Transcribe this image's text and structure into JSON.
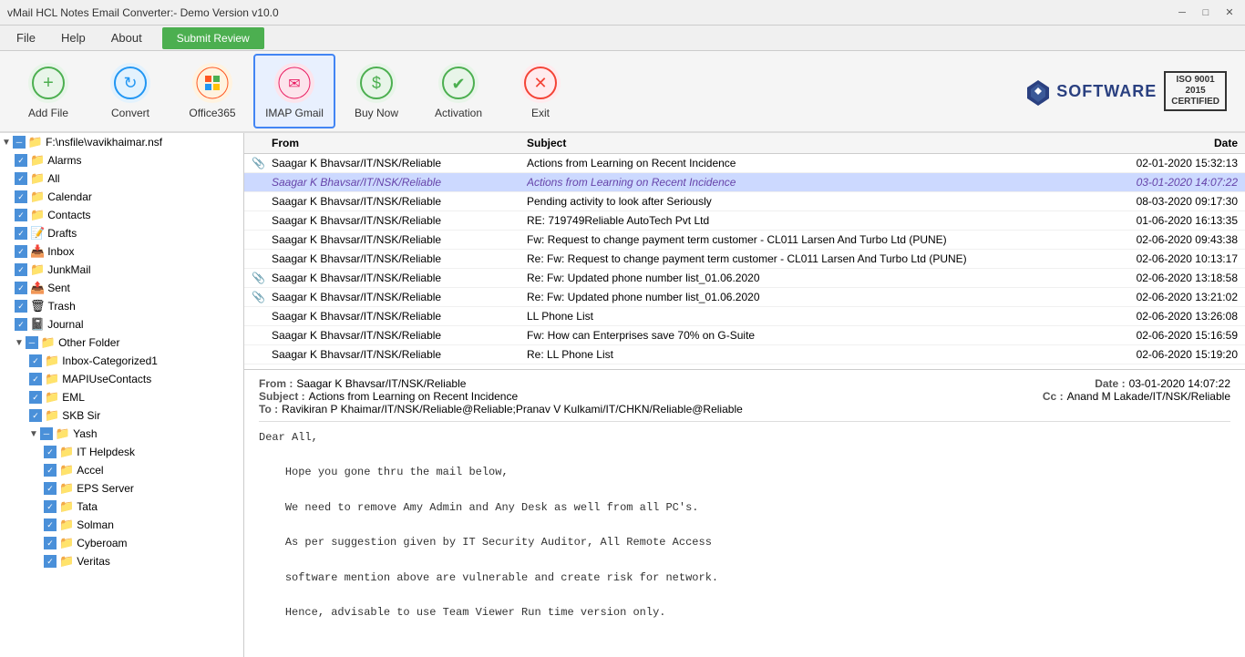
{
  "titlebar": {
    "title": "vMail HCL Notes Email Converter:- Demo Version v10.0",
    "minimize": "─",
    "maximize": "□",
    "close": "✕"
  },
  "menubar": {
    "items": [
      "File",
      "Help",
      "About"
    ],
    "submit_review": "Submit Review"
  },
  "toolbar": {
    "buttons": [
      {
        "id": "add-file",
        "label": "Add File",
        "icon": "➕",
        "icon_class": "icon-add"
      },
      {
        "id": "convert",
        "label": "Convert",
        "icon": "🔄",
        "icon_class": "icon-convert"
      },
      {
        "id": "office365",
        "label": "Office365",
        "icon": "⊞",
        "icon_class": "icon-office"
      },
      {
        "id": "imap-gmail",
        "label": "IMAP Gmail",
        "icon": "✉",
        "icon_class": "icon-imap",
        "active": true
      },
      {
        "id": "buy-now",
        "label": "Buy Now",
        "icon": "💲",
        "icon_class": "icon-buy"
      },
      {
        "id": "activation",
        "label": "Activation",
        "icon": "✔",
        "icon_class": "icon-activation"
      },
      {
        "id": "exit",
        "label": "Exit",
        "icon": "✕",
        "icon_class": "icon-exit"
      }
    ],
    "logo_text": "SOFTWARE",
    "iso_line1": "ISO 9001",
    "iso_line2": "2015",
    "iso_line3": "CERTIFIED"
  },
  "sidebar": {
    "root_path": "F:\\nsfile\\vavikhaimar.nsf",
    "folders": [
      {
        "name": "Alarms",
        "level": 1,
        "checked": true,
        "icon": "📁"
      },
      {
        "name": "All",
        "level": 1,
        "checked": true,
        "icon": "📁"
      },
      {
        "name": "Calendar",
        "level": 1,
        "checked": true,
        "icon": "📁"
      },
      {
        "name": "Contacts",
        "level": 1,
        "checked": true,
        "icon": "📁"
      },
      {
        "name": "Drafts",
        "level": 1,
        "checked": true,
        "icon": "📝"
      },
      {
        "name": "Inbox",
        "level": 1,
        "checked": true,
        "icon": "📥"
      },
      {
        "name": "JunkMail",
        "level": 1,
        "checked": true,
        "icon": "📁"
      },
      {
        "name": "Sent",
        "level": 1,
        "checked": true,
        "icon": "📤"
      },
      {
        "name": "Trash",
        "level": 1,
        "checked": true,
        "icon": "🗑"
      },
      {
        "name": "Journal",
        "level": 1,
        "checked": true,
        "icon": "📓"
      },
      {
        "name": "Other Folder",
        "level": 1,
        "checked": true,
        "icon": "📁",
        "collapsed": false
      },
      {
        "name": "Inbox-Categorized1",
        "level": 2,
        "checked": true,
        "icon": "📁"
      },
      {
        "name": "MAPIUseContacts",
        "level": 2,
        "checked": true,
        "icon": "📁"
      },
      {
        "name": "EML",
        "level": 2,
        "checked": true,
        "icon": "📁"
      },
      {
        "name": "SKB Sir",
        "level": 2,
        "checked": true,
        "icon": "📁"
      },
      {
        "name": "Yash",
        "level": 2,
        "checked": true,
        "icon": "📁",
        "collapsed": false
      },
      {
        "name": "IT Helpdesk",
        "level": 3,
        "checked": true,
        "icon": "📁"
      },
      {
        "name": "Accel",
        "level": 3,
        "checked": true,
        "icon": "📁"
      },
      {
        "name": "EPS Server",
        "level": 3,
        "checked": true,
        "icon": "📁"
      },
      {
        "name": "Tata",
        "level": 3,
        "checked": true,
        "icon": "📁"
      },
      {
        "name": "Solman",
        "level": 3,
        "checked": true,
        "icon": "📁"
      },
      {
        "name": "Cyberoam",
        "level": 3,
        "checked": true,
        "icon": "📁"
      },
      {
        "name": "Veritas",
        "level": 3,
        "checked": true,
        "icon": "📁"
      }
    ]
  },
  "email_list": {
    "headers": {
      "attach": "",
      "from": "From",
      "subject": "Subject",
      "date": "Date"
    },
    "emails": [
      {
        "attach": false,
        "from": "Saagar K Bhavsar/IT/NSK/Reliable",
        "subject": "Actions from Learning on Recent Incidence",
        "date": "02-01-2020 15:32:13",
        "selected": false
      },
      {
        "attach": false,
        "from": "Saagar K Bhavsar/IT/NSK/Reliable",
        "subject": "Actions from Learning on Recent Incidence",
        "date": "03-01-2020 14:07:22",
        "selected": true
      },
      {
        "attach": false,
        "from": "Saagar K Bhavsar/IT/NSK/Reliable",
        "subject": "Pending activity to look after Seriously",
        "date": "08-03-2020 09:17:30",
        "selected": false
      },
      {
        "attach": false,
        "from": "Saagar K Bhavsar/IT/NSK/Reliable",
        "subject": "RE: 719749Reliable AutoTech Pvt Ltd",
        "date": "01-06-2020 16:13:35",
        "selected": false
      },
      {
        "attach": false,
        "from": "Saagar K Bhavsar/IT/NSK/Reliable",
        "subject": "Fw: Request to change payment term customer - CL011 Larsen And Turbo Ltd (PUNE)",
        "date": "02-06-2020 09:43:38",
        "selected": false
      },
      {
        "attach": false,
        "from": "Saagar K Bhavsar/IT/NSK/Reliable",
        "subject": "Re: Fw: Request to change payment term customer - CL011 Larsen And Turbo Ltd (PUNE)",
        "date": "02-06-2020 10:13:17",
        "selected": false
      },
      {
        "attach": true,
        "from": "Saagar K Bhavsar/IT/NSK/Reliable",
        "subject": "Re: Fw: Updated phone number list_01.06.2020",
        "date": "02-06-2020 13:18:58",
        "selected": false
      },
      {
        "attach": true,
        "from": "Saagar K Bhavsar/IT/NSK/Reliable",
        "subject": "Re: Fw: Updated phone number list_01.06.2020",
        "date": "02-06-2020 13:21:02",
        "selected": false
      },
      {
        "attach": false,
        "from": "Saagar K Bhavsar/IT/NSK/Reliable",
        "subject": "LL Phone List",
        "date": "02-06-2020 13:26:08",
        "selected": false
      },
      {
        "attach": false,
        "from": "Saagar K Bhavsar/IT/NSK/Reliable",
        "subject": "Fw: How can Enterprises save 70% on G-Suite",
        "date": "02-06-2020 15:16:59",
        "selected": false
      },
      {
        "attach": false,
        "from": "Saagar K Bhavsar/IT/NSK/Reliable",
        "subject": "Re: LL Phone List",
        "date": "02-06-2020 15:19:20",
        "selected": false
      }
    ]
  },
  "email_preview": {
    "from_label": "From :",
    "from_value": "Saagar K Bhavsar/IT/NSK/Reliable",
    "date_label": "Date :",
    "date_value": "03-01-2020 14:07:22",
    "subject_label": "Subject :",
    "subject_value": "Actions from Learning on Recent Incidence",
    "to_label": "To :",
    "to_value": "Ravikiran P Khaimar/IT/NSK/Reliable@Reliable;Pranav V Kulkami/IT/CHKN/Reliable@Reliable",
    "cc_label": "Cc :",
    "cc_value": "Anand M Lakade/IT/NSK/Reliable",
    "body": "Dear All,\n\n    Hope you gone thru the mail below,\n\n    We need to remove Amy Admin and Any Desk as well from all PC's.\n\n    As per suggestion given by IT Security Auditor, All Remote Access\n\n    software mention above are vulnerable and create risk for network.\n\n    Hence, advisable to use Team Viewer Run time version only."
  }
}
